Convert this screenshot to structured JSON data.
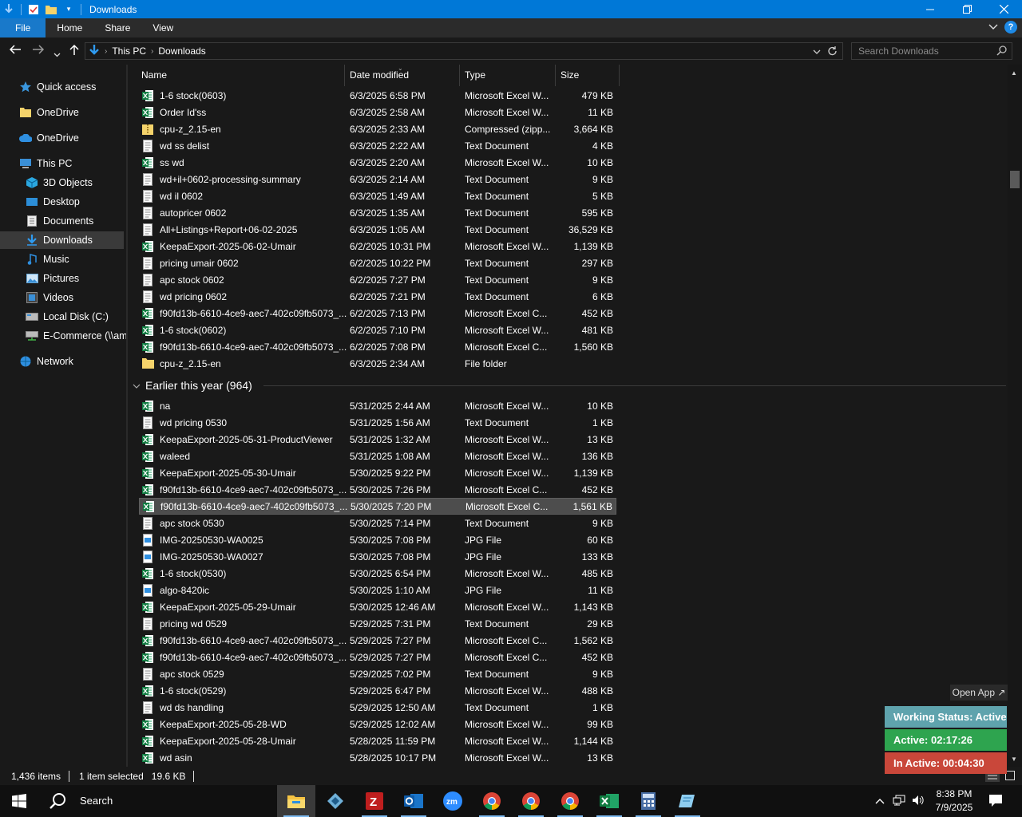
{
  "window": {
    "title": "Downloads",
    "minimize": "—",
    "maximize": "❐",
    "close": "✕"
  },
  "ribbon": {
    "tabs": [
      "File",
      "Home",
      "Share",
      "View"
    ]
  },
  "address": {
    "crumbs": [
      "This PC",
      "Downloads"
    ],
    "search_placeholder": "Search Downloads"
  },
  "sidebar": {
    "items": [
      {
        "label": "Quick access",
        "icon": "star-icon"
      },
      {
        "label": "OneDrive",
        "icon": "folder-icon"
      },
      {
        "label": "OneDrive",
        "icon": "cloud-icon"
      },
      {
        "label": "This PC",
        "icon": "computer-icon"
      },
      {
        "label": "3D Objects",
        "icon": "cube-icon"
      },
      {
        "label": "Desktop",
        "icon": "desktop-icon"
      },
      {
        "label": "Documents",
        "icon": "document-icon"
      },
      {
        "label": "Downloads",
        "icon": "download-icon"
      },
      {
        "label": "Music",
        "icon": "music-icon"
      },
      {
        "label": "Pictures",
        "icon": "pictures-icon"
      },
      {
        "label": "Videos",
        "icon": "videos-icon"
      },
      {
        "label": "Local Disk (C:)",
        "icon": "disk-icon"
      },
      {
        "label": "E-Commerce (\\\\am",
        "icon": "network-drive-icon"
      },
      {
        "label": "Network",
        "icon": "network-icon"
      }
    ]
  },
  "columns": {
    "name": "Name",
    "date": "Date modified",
    "type": "Type",
    "size": "Size"
  },
  "files_top": [
    {
      "name": "1-6 stock(0603)",
      "date": "6/3/2025 6:58 PM",
      "type": "Microsoft Excel W...",
      "size": "479 KB",
      "icon": "excel"
    },
    {
      "name": "Order Id'ss",
      "date": "6/3/2025 2:58 AM",
      "type": "Microsoft Excel W...",
      "size": "11 KB",
      "icon": "excel"
    },
    {
      "name": "cpu-z_2.15-en",
      "date": "6/3/2025 2:33 AM",
      "type": "Compressed (zipp...",
      "size": "3,664 KB",
      "icon": "zip"
    },
    {
      "name": "wd ss delist",
      "date": "6/3/2025 2:22 AM",
      "type": "Text Document",
      "size": "4 KB",
      "icon": "text"
    },
    {
      "name": "ss wd",
      "date": "6/3/2025 2:20 AM",
      "type": "Microsoft Excel W...",
      "size": "10 KB",
      "icon": "excel"
    },
    {
      "name": "wd+il+0602-processing-summary",
      "date": "6/3/2025 2:14 AM",
      "type": "Text Document",
      "size": "9 KB",
      "icon": "text"
    },
    {
      "name": "wd il 0602",
      "date": "6/3/2025 1:49 AM",
      "type": "Text Document",
      "size": "5 KB",
      "icon": "text"
    },
    {
      "name": "autopricer 0602",
      "date": "6/3/2025 1:35 AM",
      "type": "Text Document",
      "size": "595 KB",
      "icon": "text"
    },
    {
      "name": "All+Listings+Report+06-02-2025",
      "date": "6/3/2025 1:05 AM",
      "type": "Text Document",
      "size": "36,529 KB",
      "icon": "text"
    },
    {
      "name": "KeepaExport-2025-06-02-Umair",
      "date": "6/2/2025 10:31 PM",
      "type": "Microsoft Excel W...",
      "size": "1,139 KB",
      "icon": "excel"
    },
    {
      "name": "pricing umair 0602",
      "date": "6/2/2025 10:22 PM",
      "type": "Text Document",
      "size": "297 KB",
      "icon": "text"
    },
    {
      "name": "apc stock 0602",
      "date": "6/2/2025 7:27 PM",
      "type": "Text Document",
      "size": "9 KB",
      "icon": "text"
    },
    {
      "name": "wd pricing 0602",
      "date": "6/2/2025 7:21 PM",
      "type": "Text Document",
      "size": "6 KB",
      "icon": "text"
    },
    {
      "name": "f90fd13b-6610-4ce9-aec7-402c09fb5073_...",
      "date": "6/2/2025 7:13 PM",
      "type": "Microsoft Excel C...",
      "size": "452 KB",
      "icon": "excel"
    },
    {
      "name": "1-6 stock(0602)",
      "date": "6/2/2025 7:10 PM",
      "type": "Microsoft Excel W...",
      "size": "481 KB",
      "icon": "excel"
    },
    {
      "name": "f90fd13b-6610-4ce9-aec7-402c09fb5073_...",
      "date": "6/2/2025 7:08 PM",
      "type": "Microsoft Excel C...",
      "size": "1,560 KB",
      "icon": "excel"
    },
    {
      "name": "cpu-z_2.15-en",
      "date": "6/3/2025 2:34 AM",
      "type": "File folder",
      "size": "",
      "icon": "folder"
    }
  ],
  "group": {
    "label": "Earlier this year (964)"
  },
  "files_earlier": [
    {
      "name": "na",
      "date": "5/31/2025 2:44 AM",
      "type": "Microsoft Excel W...",
      "size": "10 KB",
      "icon": "excel"
    },
    {
      "name": "wd pricing 0530",
      "date": "5/31/2025 1:56 AM",
      "type": "Text Document",
      "size": "1 KB",
      "icon": "text"
    },
    {
      "name": "KeepaExport-2025-05-31-ProductViewer",
      "date": "5/31/2025 1:32 AM",
      "type": "Microsoft Excel W...",
      "size": "13 KB",
      "icon": "excel"
    },
    {
      "name": "waleed",
      "date": "5/31/2025 1:08 AM",
      "type": "Microsoft Excel W...",
      "size": "136 KB",
      "icon": "excel"
    },
    {
      "name": "KeepaExport-2025-05-30-Umair",
      "date": "5/30/2025 9:22 PM",
      "type": "Microsoft Excel W...",
      "size": "1,139 KB",
      "icon": "excel"
    },
    {
      "name": "f90fd13b-6610-4ce9-aec7-402c09fb5073_...",
      "date": "5/30/2025 7:26 PM",
      "type": "Microsoft Excel C...",
      "size": "452 KB",
      "icon": "excel"
    },
    {
      "name": "f90fd13b-6610-4ce9-aec7-402c09fb5073_...",
      "date": "5/30/2025 7:20 PM",
      "type": "Microsoft Excel C...",
      "size": "1,561 KB",
      "icon": "excel",
      "selected": true
    },
    {
      "name": "apc stock 0530",
      "date": "5/30/2025 7:14 PM",
      "type": "Text Document",
      "size": "9 KB",
      "icon": "text"
    },
    {
      "name": "IMG-20250530-WA0025",
      "date": "5/30/2025 7:08 PM",
      "type": "JPG File",
      "size": "60 KB",
      "icon": "jpg"
    },
    {
      "name": "IMG-20250530-WA0027",
      "date": "5/30/2025 7:08 PM",
      "type": "JPG File",
      "size": "133 KB",
      "icon": "jpg"
    },
    {
      "name": "1-6 stock(0530)",
      "date": "5/30/2025 6:54 PM",
      "type": "Microsoft Excel W...",
      "size": "485 KB",
      "icon": "excel"
    },
    {
      "name": "algo-8420ic",
      "date": "5/30/2025 1:10 AM",
      "type": "JPG File",
      "size": "11 KB",
      "icon": "jpg"
    },
    {
      "name": "KeepaExport-2025-05-29-Umair",
      "date": "5/30/2025 12:46 AM",
      "type": "Microsoft Excel W...",
      "size": "1,143 KB",
      "icon": "excel"
    },
    {
      "name": "pricing wd 0529",
      "date": "5/29/2025 7:31 PM",
      "type": "Text Document",
      "size": "29 KB",
      "icon": "text"
    },
    {
      "name": "f90fd13b-6610-4ce9-aec7-402c09fb5073_...",
      "date": "5/29/2025 7:27 PM",
      "type": "Microsoft Excel C...",
      "size": "1,562 KB",
      "icon": "excel"
    },
    {
      "name": "f90fd13b-6610-4ce9-aec7-402c09fb5073_...",
      "date": "5/29/2025 7:27 PM",
      "type": "Microsoft Excel C...",
      "size": "452 KB",
      "icon": "excel"
    },
    {
      "name": "apc stock 0529",
      "date": "5/29/2025 7:02 PM",
      "type": "Text Document",
      "size": "9 KB",
      "icon": "text"
    },
    {
      "name": "1-6 stock(0529)",
      "date": "5/29/2025 6:47 PM",
      "type": "Microsoft Excel W...",
      "size": "488 KB",
      "icon": "excel"
    },
    {
      "name": "wd ds handling",
      "date": "5/29/2025 12:50 AM",
      "type": "Text Document",
      "size": "1 KB",
      "icon": "text"
    },
    {
      "name": "KeepaExport-2025-05-28-WD",
      "date": "5/29/2025 12:02 AM",
      "type": "Microsoft Excel W...",
      "size": "99 KB",
      "icon": "excel"
    },
    {
      "name": "KeepaExport-2025-05-28-Umair",
      "date": "5/28/2025 11:59 PM",
      "type": "Microsoft Excel W...",
      "size": "1,144 KB",
      "icon": "excel"
    },
    {
      "name": "wd asin",
      "date": "5/28/2025 10:17 PM",
      "type": "Microsoft Excel W...",
      "size": "13 KB",
      "icon": "excel"
    }
  ],
  "status": {
    "items": "1,436 items",
    "selected": "1 item selected",
    "size": "19.6 KB"
  },
  "widget": {
    "open_app": "Open App ↗",
    "working": "Working Status: Active",
    "active": "Active: 02:17:26",
    "inactive": "In Active: 00:04:30",
    "colors": {
      "working": "#5fa3ad",
      "active": "#2ea44f",
      "inactive": "#c9473a"
    }
  },
  "taskbar": {
    "search_label": "Search",
    "time": "8:38 PM",
    "date": "7/9/2025",
    "apps": [
      "file-explorer-icon",
      "app-diamond-icon",
      "filezilla-icon",
      "outlook-icon",
      "zoom-icon",
      "chrome-icon",
      "chrome-icon",
      "chrome-icon",
      "excel-icon",
      "calculator-icon",
      "notes-icon"
    ]
  }
}
